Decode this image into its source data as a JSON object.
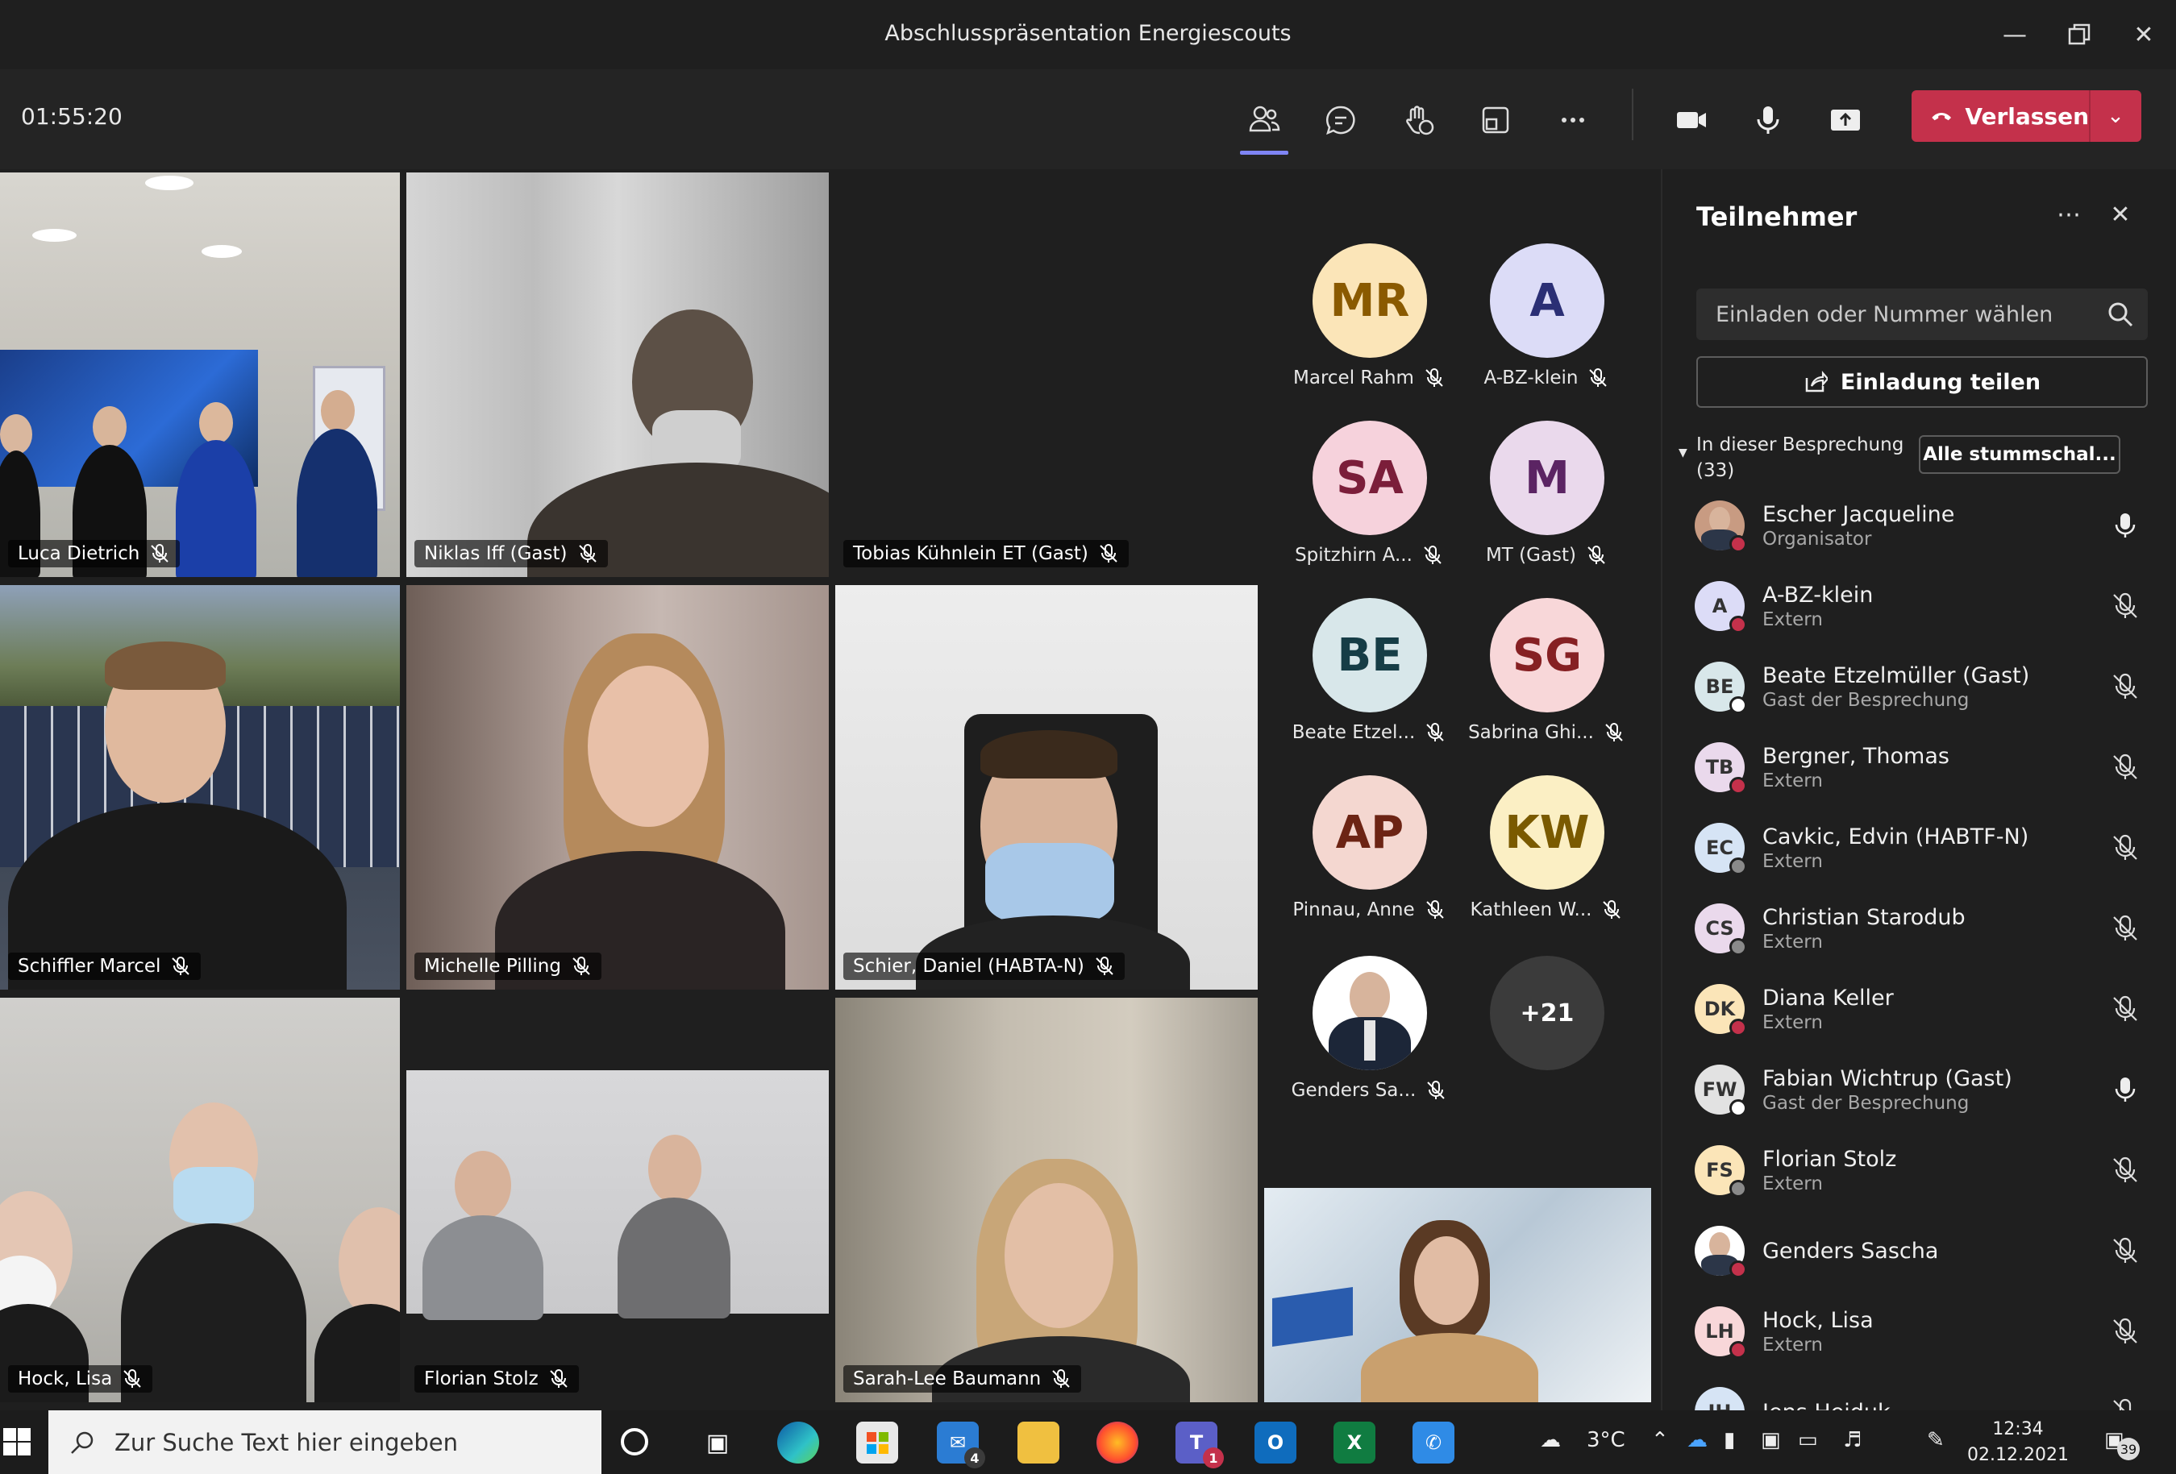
{
  "window": {
    "title": "Abschlusspräsentation Energiescouts"
  },
  "toolbar": {
    "timer": "01:55:20",
    "leave_label": "Verlassen"
  },
  "tiles": [
    {
      "name": "Luca Dietrich"
    },
    {
      "name": "Niklas Iff (Gast)"
    },
    {
      "name": "Tobias Kühnlein ET (Gast)"
    },
    {
      "name": "Schiffler Marcel"
    },
    {
      "name": "Michelle Pilling"
    },
    {
      "name": "Schier, Daniel (HABTA-N)"
    },
    {
      "name": "Hock, Lisa"
    },
    {
      "name": "Florian Stolz"
    },
    {
      "name": "Sarah-Lee Baumann"
    }
  ],
  "avatars": [
    {
      "initials": "MR",
      "name": "Marcel Rahm",
      "bg": "#fbe5b8",
      "fg": "#8a5a00"
    },
    {
      "initials": "A",
      "name": "A-BZ-klein",
      "bg": "#dcdcf7",
      "fg": "#2b2f75"
    },
    {
      "initials": "SA",
      "name": "Spitzhirn A...",
      "bg": "#f6d2dc",
      "fg": "#7b1e3a"
    },
    {
      "initials": "M",
      "name": "MT (Gast)",
      "bg": "#ead9ec",
      "fg": "#5b2463"
    },
    {
      "initials": "BE",
      "name": "Beate Etzel...",
      "bg": "#d8e7ea",
      "fg": "#163d46"
    },
    {
      "initials": "SG",
      "name": "Sabrina Ghi...",
      "bg": "#f8d7d9",
      "fg": "#862023"
    },
    {
      "initials": "AP",
      "name": "Pinnau, Anne",
      "bg": "#f4d7d0",
      "fg": "#6c2414"
    },
    {
      "initials": "KW",
      "name": "Kathleen W...",
      "bg": "#fbefc4",
      "fg": "#7a5a00"
    },
    {
      "initials": "",
      "name": "Genders Sa...",
      "bg": "#ffffff",
      "fg": "#000000"
    },
    {
      "initials": "+21",
      "name": "",
      "bg": "#3b3b3b",
      "fg": "#ffffff"
    }
  ],
  "panel": {
    "title": "Teilnehmer",
    "search_placeholder": "Einladen oder Nummer wählen",
    "share_label": "Einladung teilen",
    "section_label": "In dieser Besprechung",
    "section_count": "(33)",
    "mute_all_label": "Alle stummschal...",
    "participants": [
      {
        "initials": "",
        "name": "Escher Jacqueline",
        "role": "Organisator",
        "bg": "#c89b82",
        "status": "#c4314b",
        "mic": "on"
      },
      {
        "initials": "A",
        "name": "A-BZ-klein",
        "role": "Extern",
        "bg": "#dcdcf7",
        "status": "#c4314b",
        "mic": "off"
      },
      {
        "initials": "BE",
        "name": "Beate Etzelmüller (Gast)",
        "role": "Gast der Besprechung",
        "bg": "#d8e7ea",
        "status": "#ffffff",
        "mic": "off"
      },
      {
        "initials": "TB",
        "name": "Bergner, Thomas",
        "role": "Extern",
        "bg": "#ead9ec",
        "status": "#c4314b",
        "mic": "off"
      },
      {
        "initials": "EC",
        "name": "Cavkic, Edvin (HABTF-N)",
        "role": "Extern",
        "bg": "#d6e4f5",
        "status": "#8a8a8a",
        "mic": "off"
      },
      {
        "initials": "CS",
        "name": "Christian Starodub",
        "role": "Extern",
        "bg": "#ead9ec",
        "status": "#8a8a8a",
        "mic": "off"
      },
      {
        "initials": "DK",
        "name": "Diana Keller",
        "role": "Extern",
        "bg": "#fbe5b8",
        "status": "#c4314b",
        "mic": "off"
      },
      {
        "initials": "FW",
        "name": "Fabian Wichtrup (Gast)",
        "role": "Gast der Besprechung",
        "bg": "#e2e2e2",
        "status": "#ffffff",
        "mic": "on"
      },
      {
        "initials": "FS",
        "name": "Florian Stolz",
        "role": "Extern",
        "bg": "#fbe5b8",
        "status": "#8a8a8a",
        "mic": "off"
      },
      {
        "initials": "",
        "name": "Genders Sascha",
        "role": "",
        "bg": "#ffffff",
        "status": "#c4314b",
        "mic": "off"
      },
      {
        "initials": "LH",
        "name": "Hock, Lisa",
        "role": "Extern",
        "bg": "#f8d7d9",
        "status": "#c4314b",
        "mic": "off"
      },
      {
        "initials": "JH",
        "name": "Jens Heiduk",
        "role": "",
        "bg": "#d6e4f5",
        "status": "#c4314b",
        "mic": "off"
      }
    ]
  },
  "taskbar": {
    "search_placeholder": "Zur Suche Text hier eingeben",
    "weather": "3°C",
    "time": "12:34",
    "date": "02.12.2021",
    "mail_badge": "4",
    "teams_badge": "1",
    "notif_count": "39"
  }
}
